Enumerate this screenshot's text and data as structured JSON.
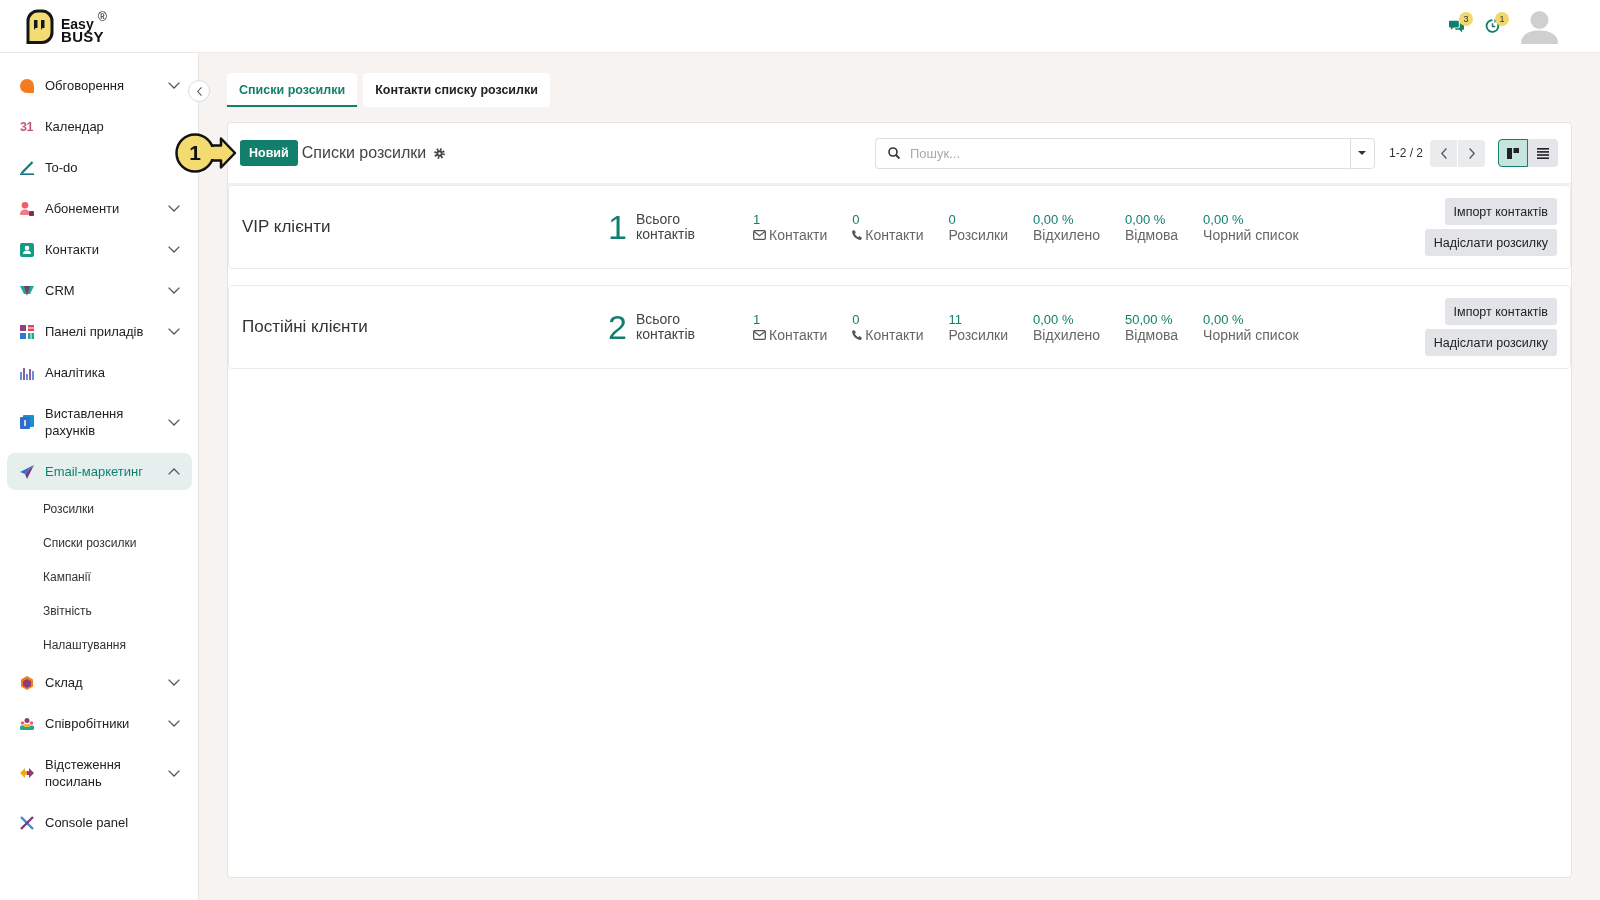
{
  "header": {
    "logo": {
      "word_top": "Easy",
      "word_bottom": "BUSY",
      "mark": "®"
    },
    "indicators": [
      {
        "kind": "messages",
        "count": "3"
      },
      {
        "kind": "activities",
        "count": "1"
      }
    ]
  },
  "sidebar": {
    "items": [
      {
        "label": "Обговорення",
        "kind": "group",
        "expanded": false,
        "selected": false
      },
      {
        "label": "Календар",
        "kind": "link",
        "icon_text": "31",
        "selected": false
      },
      {
        "label": "To-do",
        "kind": "link",
        "selected": false
      },
      {
        "label": "Абонементи",
        "kind": "group",
        "expanded": false,
        "selected": false
      },
      {
        "label": "Контакти",
        "kind": "group",
        "expanded": false,
        "selected": false
      },
      {
        "label": "CRM",
        "kind": "group",
        "expanded": false,
        "selected": false
      },
      {
        "label": "Панелі приладів",
        "kind": "group",
        "expanded": false,
        "selected": false
      },
      {
        "label": "Аналітика",
        "kind": "link",
        "selected": false
      },
      {
        "label": "Виставлення рахунків",
        "kind": "group",
        "expanded": false,
        "selected": false
      },
      {
        "label": "Email-маркетинг",
        "kind": "group",
        "expanded": true,
        "selected": true,
        "children": [
          {
            "label": "Розсилки"
          },
          {
            "label": "Списки розсилки"
          },
          {
            "label": "Кампанії"
          },
          {
            "label": "Звітність"
          },
          {
            "label": "Налаштування"
          }
        ]
      },
      {
        "label": "Склад",
        "kind": "group",
        "expanded": false,
        "selected": false
      },
      {
        "label": "Співробітники",
        "kind": "group",
        "expanded": false,
        "selected": false
      },
      {
        "label": "Відстеження посилань",
        "kind": "group",
        "expanded": false,
        "selected": false
      },
      {
        "label": "Console panel",
        "kind": "link",
        "selected": false
      }
    ]
  },
  "tabs": [
    {
      "label": "Списки розсилки",
      "selected": true
    },
    {
      "label": "Контакти списку розсилки",
      "selected": false
    }
  ],
  "control_panel": {
    "new_button": "Новий",
    "title": "Списки розсилки",
    "search": {
      "placeholder": "Пошук..."
    },
    "pager": "1-2 / 2",
    "views": [
      {
        "kind": "kanban",
        "selected": true
      },
      {
        "kind": "list",
        "selected": false
      }
    ]
  },
  "callout": {
    "label": "1"
  },
  "mailing_lists": [
    {
      "name": "VIP клієнти",
      "total": "1",
      "total_label": "Всього контактів",
      "stats": [
        {
          "kind": "email",
          "value": "1",
          "label": "Контакти"
        },
        {
          "kind": "phone",
          "value": "0",
          "label": "Контакти"
        },
        {
          "kind": "plain",
          "value": "0",
          "label": "Розсилки"
        },
        {
          "kind": "plain",
          "value": "0,00 %",
          "label": "Відхилено"
        },
        {
          "kind": "plain",
          "value": "0,00 %",
          "label": "Відмова"
        },
        {
          "kind": "plain",
          "value": "0,00 %",
          "label": "Чорний список"
        }
      ],
      "buttons": [
        "Імпорт контактів",
        "Надіслати розсилку"
      ]
    },
    {
      "name": "Постійні клієнти",
      "total": "2",
      "total_label": "Всього контактів",
      "stats": [
        {
          "kind": "email",
          "value": "1",
          "label": "Контакти"
        },
        {
          "kind": "phone",
          "value": "0",
          "label": "Контакти"
        },
        {
          "kind": "plain",
          "value": "11",
          "label": "Розсилки"
        },
        {
          "kind": "plain",
          "value": "0,00 %",
          "label": "Відхилено"
        },
        {
          "kind": "plain",
          "value": "50,00 %",
          "label": "Відмова"
        },
        {
          "kind": "plain",
          "value": "0,00 %",
          "label": "Чорний список"
        }
      ],
      "buttons": [
        "Імпорт контактів",
        "Надіслати розсилку"
      ]
    }
  ]
}
